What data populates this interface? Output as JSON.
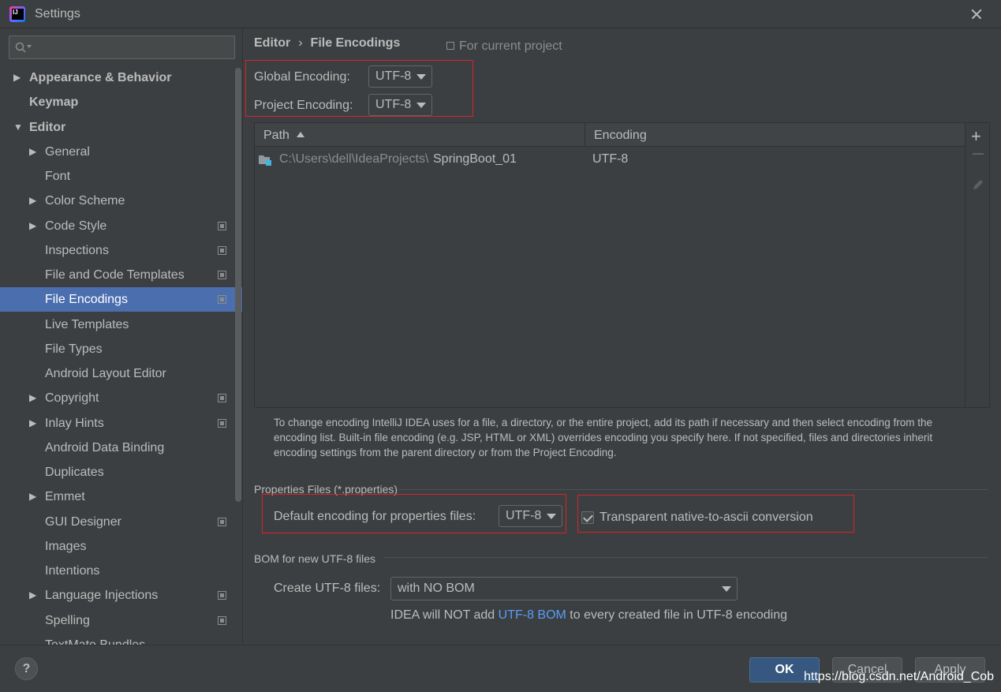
{
  "window": {
    "title": "Settings"
  },
  "sidebar": {
    "search_placeholder": "",
    "items": [
      {
        "label": "Appearance & Behavior",
        "level": 0,
        "arrow": "▶",
        "bold": true,
        "project": false
      },
      {
        "label": "Keymap",
        "level": 0,
        "arrow": "",
        "bold": true,
        "project": false
      },
      {
        "label": "Editor",
        "level": 0,
        "arrow": "▼",
        "bold": true,
        "project": false
      },
      {
        "label": "General",
        "level": 1,
        "arrow": "▶",
        "bold": false,
        "project": false
      },
      {
        "label": "Font",
        "level": 1,
        "arrow": "",
        "bold": false,
        "project": false
      },
      {
        "label": "Color Scheme",
        "level": 1,
        "arrow": "▶",
        "bold": false,
        "project": false
      },
      {
        "label": "Code Style",
        "level": 1,
        "arrow": "▶",
        "bold": false,
        "project": true
      },
      {
        "label": "Inspections",
        "level": 1,
        "arrow": "",
        "bold": false,
        "project": true
      },
      {
        "label": "File and Code Templates",
        "level": 1,
        "arrow": "",
        "bold": false,
        "project": true
      },
      {
        "label": "File Encodings",
        "level": 1,
        "arrow": "",
        "bold": false,
        "project": true,
        "selected": true
      },
      {
        "label": "Live Templates",
        "level": 1,
        "arrow": "",
        "bold": false,
        "project": false
      },
      {
        "label": "File Types",
        "level": 1,
        "arrow": "",
        "bold": false,
        "project": false
      },
      {
        "label": "Android Layout Editor",
        "level": 1,
        "arrow": "",
        "bold": false,
        "project": false
      },
      {
        "label": "Copyright",
        "level": 1,
        "arrow": "▶",
        "bold": false,
        "project": true
      },
      {
        "label": "Inlay Hints",
        "level": 1,
        "arrow": "▶",
        "bold": false,
        "project": true
      },
      {
        "label": "Android Data Binding",
        "level": 1,
        "arrow": "",
        "bold": false,
        "project": false
      },
      {
        "label": "Duplicates",
        "level": 1,
        "arrow": "",
        "bold": false,
        "project": false
      },
      {
        "label": "Emmet",
        "level": 1,
        "arrow": "▶",
        "bold": false,
        "project": false
      },
      {
        "label": "GUI Designer",
        "level": 1,
        "arrow": "",
        "bold": false,
        "project": true
      },
      {
        "label": "Images",
        "level": 1,
        "arrow": "",
        "bold": false,
        "project": false
      },
      {
        "label": "Intentions",
        "level": 1,
        "arrow": "",
        "bold": false,
        "project": false
      },
      {
        "label": "Language Injections",
        "level": 1,
        "arrow": "▶",
        "bold": false,
        "project": true
      },
      {
        "label": "Spelling",
        "level": 1,
        "arrow": "",
        "bold": false,
        "project": true
      },
      {
        "label": "TextMate Bundles",
        "level": 1,
        "arrow": "",
        "bold": false,
        "project": false
      }
    ]
  },
  "header": {
    "breadcrumb_parent": "Editor",
    "breadcrumb_separator": "›",
    "breadcrumb_current": "File Encodings",
    "for_current_project": "For current project"
  },
  "encodings": {
    "global_label": "Global Encoding:",
    "global_value": "UTF-8",
    "project_label": "Project Encoding:",
    "project_value": "UTF-8"
  },
  "table": {
    "columns": [
      "Path",
      "Encoding"
    ],
    "rows": [
      {
        "path_prefix": "C:\\Users\\dell\\IdeaProjects\\",
        "path_name": "SpringBoot_01",
        "encoding": "UTF-8"
      }
    ]
  },
  "help_text": "To change encoding IntelliJ IDEA uses for a file, a directory, or the entire project, add its path if necessary and then select encoding from the encoding list. Built-in file encoding (e.g. JSP, HTML or XML) overrides encoding you specify here. If not specified, files and directories inherit encoding settings from the parent directory or from the Project Encoding.",
  "properties": {
    "section_title": "Properties Files (*.properties)",
    "default_label": "Default encoding for properties files:",
    "default_value": "UTF-8",
    "transparent_label": "Transparent native-to-ascii conversion",
    "transparent_checked": true
  },
  "bom": {
    "section_title": "BOM for new UTF-8 files",
    "create_label": "Create UTF-8 files:",
    "create_value": "with NO BOM",
    "note_prefix": "IDEA will NOT add ",
    "note_link": "UTF-8 BOM",
    "note_suffix": " to every created file in UTF-8 encoding"
  },
  "footer": {
    "help_label": "?",
    "ok_label": "OK",
    "cancel_label": "Cancel",
    "apply_label": "Apply",
    "watermark": "https://blog.csdn.net/Android_Cob"
  },
  "colors": {
    "background": "#3c3f41",
    "selection": "#4b6eaf",
    "highlight_box": "#d8232a",
    "link": "#589df6",
    "ok_button": "#365880"
  }
}
